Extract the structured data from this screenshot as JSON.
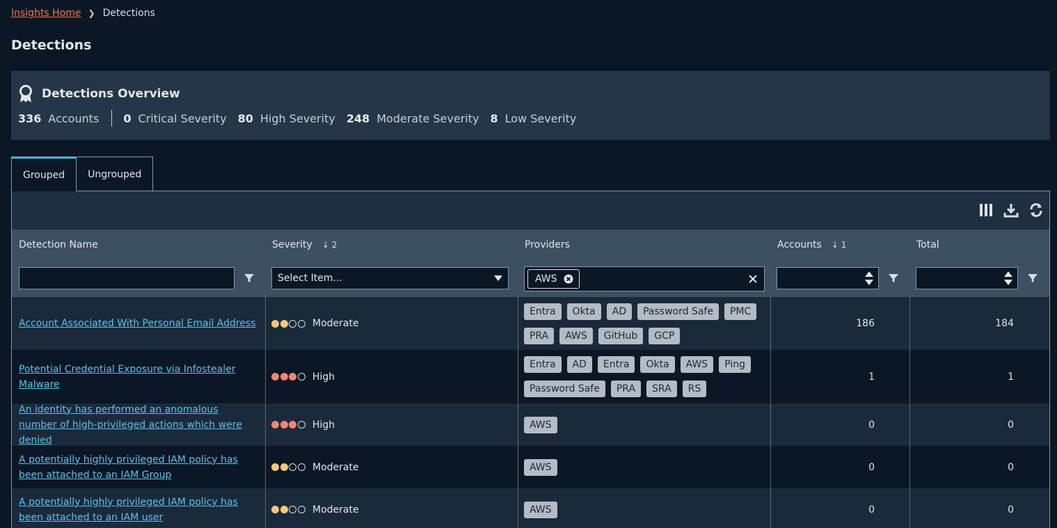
{
  "breadcrumb": {
    "home": "Insights Home",
    "current": "Detections"
  },
  "page_title": "Detections",
  "overview": {
    "title": "Detections Overview",
    "accounts_count": "336",
    "accounts_label": "Accounts",
    "critical_count": "0",
    "critical_label": "Critical Severity",
    "high_count": "80",
    "high_label": "High Severity",
    "moderate_count": "248",
    "moderate_label": "Moderate Severity",
    "low_count": "8",
    "low_label": "Low Severity"
  },
  "tabs": [
    {
      "label": "Grouped"
    },
    {
      "label": "Ungrouped"
    }
  ],
  "columns": {
    "name": "Detection Name",
    "severity": "Severity",
    "severity_sort": "2",
    "providers": "Providers",
    "accounts": "Accounts",
    "accounts_sort": "1",
    "total": "Total"
  },
  "filters": {
    "severity_placeholder": "Select Item...",
    "providers_chip": "AWS"
  },
  "rows": [
    {
      "name": "Account Associated With Personal Email Address",
      "severity": "Moderate",
      "level": 2,
      "providers": [
        "Entra",
        "Okta",
        "AD",
        "Password Safe",
        "PMC",
        "PRA",
        "AWS",
        "GitHub",
        "GCP"
      ],
      "accounts": "186",
      "total": "184"
    },
    {
      "name": "Potential Credential Exposure via Infostealer Malware",
      "severity": "High",
      "level": 3,
      "providers": [
        "Entra",
        "AD",
        "Entra",
        "Okta",
        "AWS",
        "Ping",
        "Password Safe",
        "PRA",
        "SRA",
        "RS"
      ],
      "accounts": "1",
      "total": "1"
    },
    {
      "name": "An identity has performed an anomalous number of high-privileged actions which were denied",
      "severity": "High",
      "level": 3,
      "providers": [
        "AWS"
      ],
      "accounts": "0",
      "total": "0"
    },
    {
      "name": "A potentially highly privileged IAM policy has been attached to an IAM Group",
      "severity": "Moderate",
      "level": 2,
      "providers": [
        "AWS"
      ],
      "accounts": "0",
      "total": "0"
    },
    {
      "name": "A potentially highly privileged IAM policy has been attached to an IAM user",
      "severity": "Moderate",
      "level": 2,
      "providers": [
        "AWS"
      ],
      "accounts": "0",
      "total": "0"
    }
  ]
}
